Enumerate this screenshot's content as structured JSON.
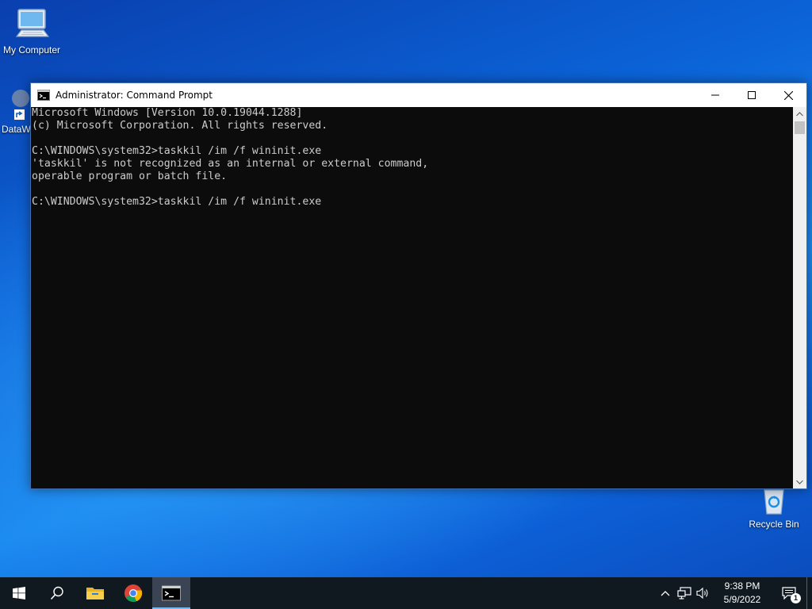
{
  "desktop": {
    "icons": [
      {
        "label": "My Computer",
        "icon": "computer-icon"
      },
      {
        "label": "DataW",
        "icon": "shortcut-icon"
      },
      {
        "label": "Recycle Bin",
        "icon": "recycle-bin-icon"
      }
    ]
  },
  "window": {
    "title": "Administrator: Command Prompt",
    "icon": "cmd-icon",
    "controls": [
      "minimize",
      "maximize",
      "close"
    ]
  },
  "console": {
    "lines": [
      "Microsoft Windows [Version 10.0.19044.1288]",
      "(c) Microsoft Corporation. All rights reserved.",
      "",
      "C:\\WINDOWS\\system32>taskkil /im /f wininit.exe",
      "'taskkil' is not recognized as an internal or external command,",
      "operable program or batch file.",
      "",
      "C:\\WINDOWS\\system32>taskkil /im /f wininit.exe"
    ]
  },
  "taskbar": {
    "buttons": [
      {
        "name": "start",
        "icon": "windows-logo-icon"
      },
      {
        "name": "search",
        "icon": "search-icon"
      },
      {
        "name": "file-explorer",
        "icon": "folder-icon"
      },
      {
        "name": "chrome",
        "icon": "chrome-icon"
      },
      {
        "name": "command-prompt",
        "icon": "cmd-icon",
        "active": true
      }
    ],
    "tray": {
      "time": "9:38 PM",
      "date": "5/9/2022",
      "notification_count": "1"
    }
  },
  "colors": {
    "console_bg": "#0c0c0c",
    "console_text": "#cccccc",
    "taskbar_bg": "#101820",
    "active_indicator": "#76b9ed"
  }
}
